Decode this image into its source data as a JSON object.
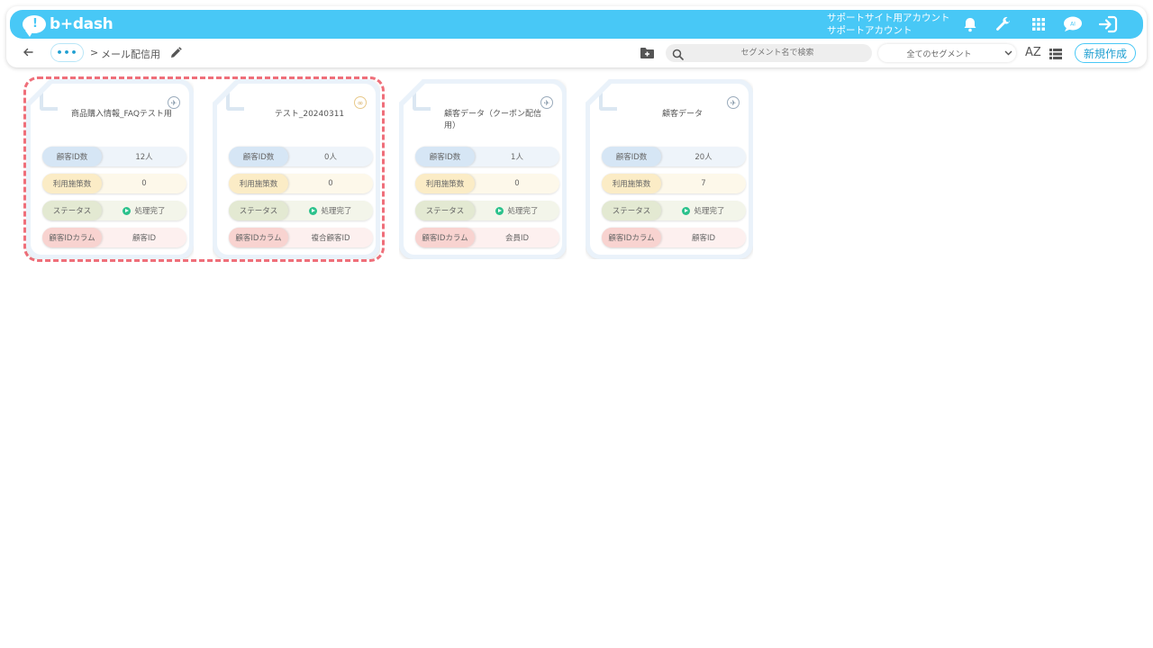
{
  "header": {
    "logo_text": "b+dash",
    "account_line1": "サポートサイト用アカウント",
    "account_line2": "サポートアカウント",
    "icons": [
      "bell-icon",
      "wrench-icon",
      "apps-grid-icon",
      "chat-bubble-icon",
      "logout-icon"
    ]
  },
  "breadcrumb": {
    "more": "•••",
    "separator": ">",
    "current": "メール配信用"
  },
  "toolbar": {
    "search_placeholder": "セグメント名で検索",
    "segment_filter": "全てのセグメント",
    "sort_label": "AZ",
    "new_button": "新規作成"
  },
  "row_labels": {
    "customer_count": "顧客ID数",
    "strategy_count": "利用施策数",
    "status": "ステータス",
    "id_column": "顧客IDカラム"
  },
  "cards": [
    {
      "title": "商品購入情報_FAQテスト用",
      "corner_icon": "rocket-icon",
      "customer_count": "12人",
      "strategy_count": "0",
      "status": "処理完了",
      "id_column": "顧客ID"
    },
    {
      "title": "テスト_20240311",
      "corner_icon": "link-icon",
      "customer_count": "0人",
      "strategy_count": "0",
      "status": "処理完了",
      "id_column": "複合顧客ID"
    },
    {
      "title": "顧客データ（クーポン配信用）",
      "corner_icon": "rocket-icon",
      "customer_count": "1人",
      "strategy_count": "0",
      "status": "処理完了",
      "id_column": "会員ID"
    },
    {
      "title": "顧客データ",
      "corner_icon": "rocket-icon",
      "customer_count": "20人",
      "strategy_count": "7",
      "status": "処理完了",
      "id_column": "顧客ID"
    }
  ],
  "colors": {
    "brand": "#48c8f6",
    "selection_outline": "#ef6f7a",
    "status_ok": "#2cc28c"
  }
}
